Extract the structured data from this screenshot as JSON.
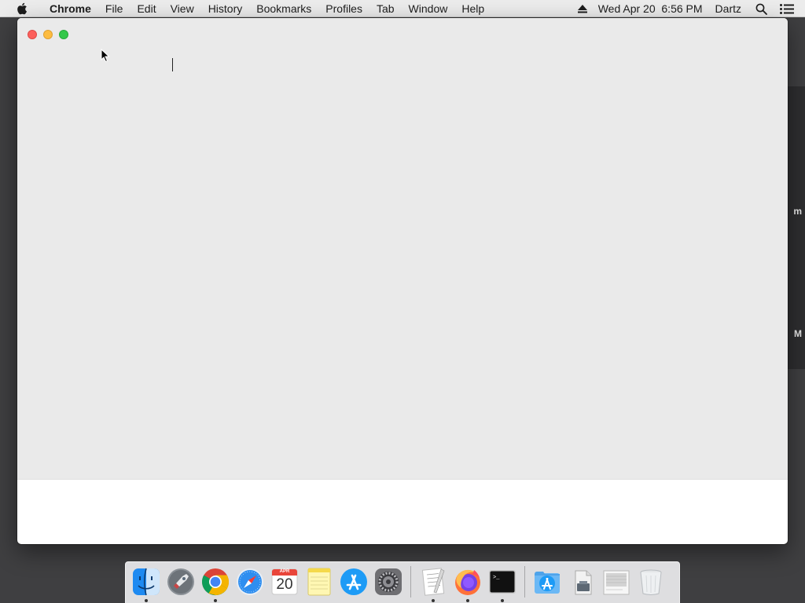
{
  "menubar": {
    "apple_icon": "apple-icon",
    "app_name": "Chrome",
    "items": [
      "File",
      "Edit",
      "View",
      "History",
      "Bookmarks",
      "Profiles",
      "Tab",
      "Window",
      "Help"
    ],
    "status": {
      "eject_icon": "eject-icon",
      "datetime": "Wed Apr 20  6:56 PM",
      "user": "Dartz",
      "search_icon": "spotlight-search-icon",
      "notification_icon": "notification-center-icon"
    }
  },
  "background_window": {
    "fragment_1": "m",
    "fragment_2": "M"
  },
  "window": {
    "app": "Chrome",
    "traffic_lights": [
      "close",
      "minimize",
      "maximize"
    ],
    "colors": {
      "close": "#fc605c",
      "minimize": "#fdbc40",
      "maximize": "#34c84a"
    }
  },
  "dock": {
    "apps": [
      {
        "name": "Finder",
        "icon": "finder-icon",
        "running": true
      },
      {
        "name": "Launchpad",
        "icon": "launchpad-icon",
        "running": false
      },
      {
        "name": "Google Chrome",
        "icon": "chrome-icon",
        "running": true
      },
      {
        "name": "Safari",
        "icon": "safari-icon",
        "running": false
      },
      {
        "name": "Calendar",
        "icon": "calendar-icon",
        "running": false
      },
      {
        "name": "Notes",
        "icon": "notes-icon",
        "running": false
      },
      {
        "name": "App Store",
        "icon": "app-store-icon",
        "running": false
      },
      {
        "name": "System Preferences",
        "icon": "system-preferences-icon",
        "running": false
      }
    ],
    "calendar": {
      "month": "APR",
      "day": "20"
    },
    "recent_apps": [
      {
        "name": "TextEdit",
        "icon": "textedit-icon",
        "running": true
      },
      {
        "name": "Firefox",
        "icon": "firefox-icon",
        "running": true
      },
      {
        "name": "Terminal",
        "icon": "terminal-icon",
        "running": true
      }
    ],
    "stacks": [
      {
        "name": "Applications",
        "icon": "applications-folder-icon"
      },
      {
        "name": "Downloads",
        "icon": "downloads-stack-icon"
      },
      {
        "name": "Document",
        "icon": "document-stack-icon"
      },
      {
        "name": "Trash",
        "icon": "trash-icon"
      }
    ],
    "terminal_prompt": ">_"
  }
}
